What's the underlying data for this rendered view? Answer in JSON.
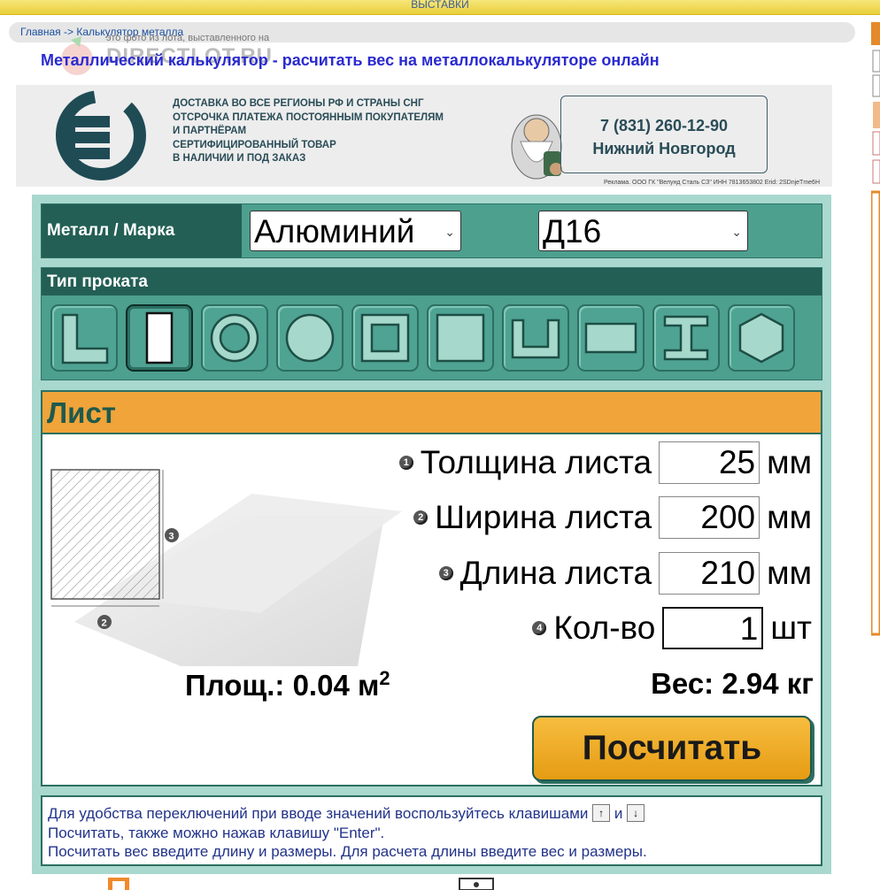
{
  "topbar": {
    "text": "ВЫСТАВКИ"
  },
  "breadcrumb": {
    "text": "Главная -> Калькулятор металла"
  },
  "watermark": {
    "note": "это фото из лота, выставленного на",
    "site": "DIRECTLOT.RU"
  },
  "page_title": "Металлический калькулятор - расчитать вес на металлокалькуляторе онлайн",
  "banner": {
    "line1": "ДОСТАВКА ВО ВСЕ РЕГИОНЫ РФ И СТРАНЫ СНГ",
    "line2": "ОТСРОЧКА ПЛАТЕЖА ПОСТОЯННЫМ ПОКУПАТЕЛЯМ",
    "line3": "И ПАРТНЁРАМ",
    "line4": "СЕРТИФИЦИРОВАННЫЙ ТОВАР",
    "line5": "В НАЛИЧИИ И ПОД ЗАКАЗ",
    "phone": "7 (831) 260-12-90",
    "city": "Нижний Новгород",
    "fine": "Реклама. ООО ГК \"Велунд Сталь СЗ\" ИНН 7813653802 Erid: 2SDnjeTme6H"
  },
  "metal": {
    "label": "Металл / Марка",
    "metal_value": "Алюминий",
    "grade_value": "Д16"
  },
  "profile": {
    "label": "Тип проката",
    "types": [
      "angle-icon",
      "sheet-icon",
      "pipe-icon",
      "round-bar-icon",
      "square-pipe-icon",
      "square-bar-icon",
      "channel-icon",
      "strip-icon",
      "beam-icon",
      "hexagon-icon"
    ],
    "active_index": 1
  },
  "form": {
    "title": "Лист",
    "fields": [
      {
        "num": "1",
        "label": "Толщина листа",
        "value": "25",
        "unit": "мм"
      },
      {
        "num": "2",
        "label": "Ширина листа",
        "value": "200",
        "unit": "мм"
      },
      {
        "num": "3",
        "label": "Длина листа",
        "value": "210",
        "unit": "мм"
      },
      {
        "num": "4",
        "label": "Кол-во",
        "value": "1",
        "unit": "шт"
      }
    ],
    "area_label": "Площ.: 0.04 м",
    "area_sup": "2",
    "weight_label": "Вес: 2.94 кг",
    "calc_button": "Посчитать"
  },
  "help": {
    "line1_pre": "Для удобства переключений при вводе значений воспользуйтесь клавишами",
    "key_up": "↑",
    "and": "и",
    "key_down": "↓",
    "line2": "Посчитать, также можно нажав клавишу \"Enter\".",
    "line3": "Посчитать вес введите длину и размеры. Для расчета длины введите вес и размеры."
  },
  "colors": {
    "accent": "#f0a43a",
    "teal_dark": "#235f55",
    "teal": "#4d9f8e",
    "panel_bg": "#a9d8ce",
    "title_blue": "#2a2ad0"
  }
}
